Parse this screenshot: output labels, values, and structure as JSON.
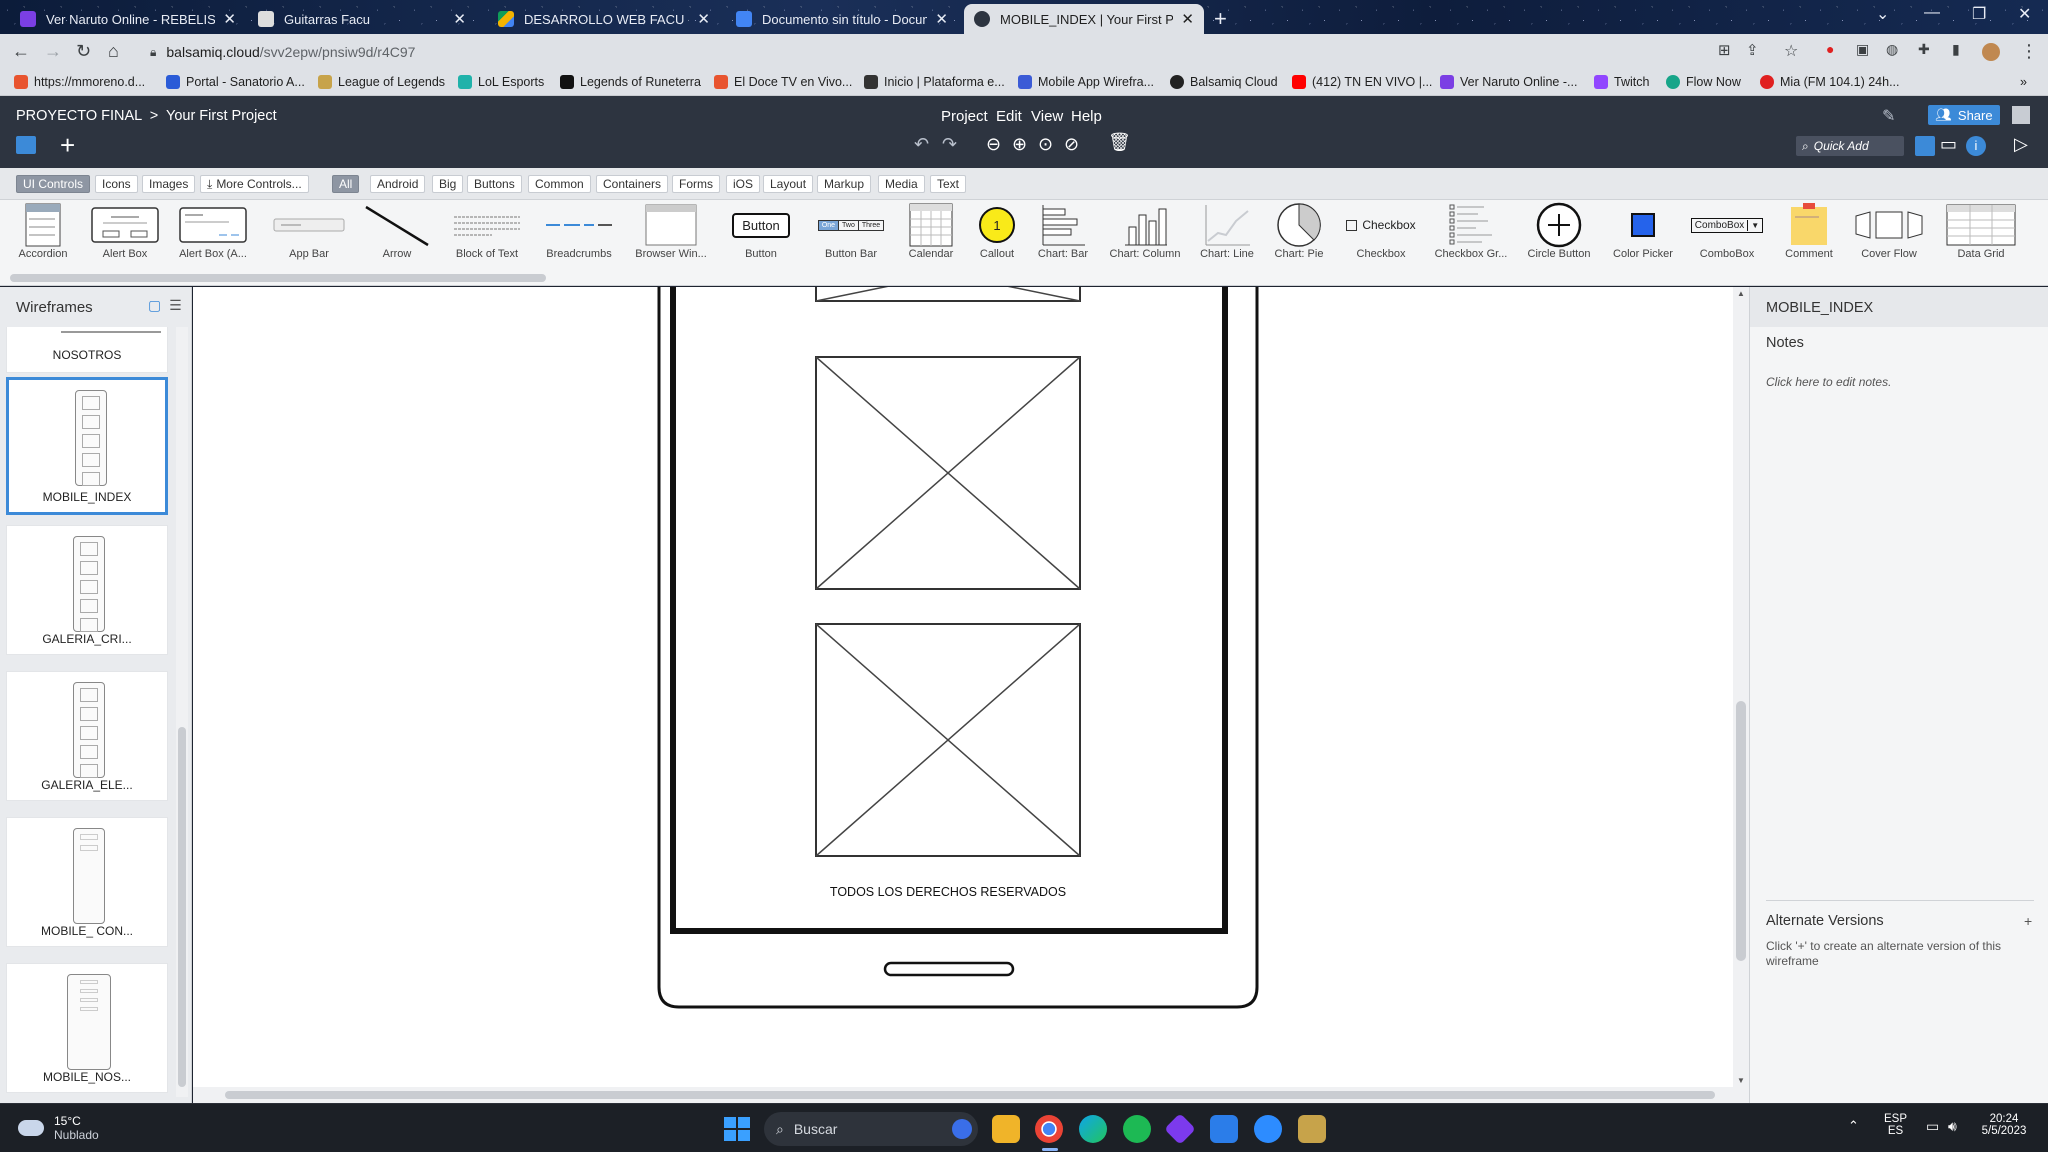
{
  "browser": {
    "tabs": [
      {
        "title": "Ver Naruto Online - REBELISPLUS",
        "color": "#7b3fe4",
        "active": false
      },
      {
        "title": "Guitarras Facu",
        "color": "#dddddd",
        "active": false
      },
      {
        "title": "DESARROLLO WEB FACU - Goog",
        "color": "#f4b400",
        "active": false
      },
      {
        "title": "Documento sin título - Documen",
        "color": "#4285f4",
        "active": false
      },
      {
        "title": "MOBILE_INDEX | Your First Projec",
        "color": "#2d3440",
        "active": true
      }
    ],
    "url_host": "balsamiq.cloud",
    "url_path": "/svv2epw/pnsiw9d/r4C97",
    "bookmarks": [
      {
        "label": "https://mmoreno.d...",
        "color": "#e8542f"
      },
      {
        "label": "Portal - Sanatorio A...",
        "color": "#2a5bd7"
      },
      {
        "label": "League of Legends",
        "color": "#c7a34a"
      },
      {
        "label": "LoL Esports",
        "color": "#20b2aa"
      },
      {
        "label": "Legends of Runeterra",
        "color": "#111111"
      },
      {
        "label": "El Doce TV en Vivo...",
        "color": "#e8542f"
      },
      {
        "label": "Inicio | Plataforma e...",
        "color": "#333333"
      },
      {
        "label": "Mobile App Wirefra...",
        "color": "#3b5bd6"
      },
      {
        "label": "Balsamiq Cloud",
        "color": "#222222"
      },
      {
        "label": "(412) TN EN VIVO |...",
        "color": "#ff0000"
      },
      {
        "label": "Ver Naruto Online -...",
        "color": "#7b3fe4"
      },
      {
        "label": "Twitch",
        "color": "#9146ff"
      },
      {
        "label": "Flow Now",
        "color": "#17a589"
      },
      {
        "label": "Mia (FM 104.1) 24h...",
        "color": "#e02020"
      }
    ]
  },
  "app": {
    "project": "PROYECTO FINAL",
    "separator": ">",
    "file": "Your First Project",
    "menu": [
      "Project",
      "Edit",
      "View",
      "Help"
    ],
    "share_label": "Share",
    "quick_add": "Quick Add"
  },
  "filters": {
    "left": [
      "UI Controls",
      "Icons",
      "Images",
      "More Controls..."
    ],
    "categories": [
      "All",
      "Android",
      "Big",
      "Buttons",
      "Common",
      "Containers",
      "Forms",
      "iOS",
      "Layout",
      "Markup",
      "Media",
      "Text"
    ]
  },
  "controls": [
    "Accordion",
    "Alert Box",
    "Alert Box (A...",
    "App Bar",
    "Arrow",
    "Block of Text",
    "Breadcrumbs",
    "Browser Win...",
    "Button",
    "Button Bar",
    "Calendar",
    "Callout",
    "Chart: Bar",
    "Chart: Column",
    "Chart: Line",
    "Chart: Pie",
    "Checkbox",
    "Checkbox Gr...",
    "Circle Button",
    "Color Picker",
    "ComboBox",
    "Comment",
    "Cover Flow",
    "Data Grid"
  ],
  "control_samples": {
    "button_text": "Button",
    "checkbox_text": "Checkbox",
    "combobox_text": "ComboBox",
    "callout_number": "1",
    "button_bar": [
      "One",
      "Two",
      "Three"
    ]
  },
  "wireframes": {
    "title": "Wireframes",
    "pages": [
      "NOSOTROS",
      "MOBILE_INDEX",
      "GALERIA_CRI...",
      "GALERIA_ELE...",
      "MOBILE_ CON...",
      "MOBILE_NOS..."
    ],
    "selected": "MOBILE_INDEX"
  },
  "canvas": {
    "footer_text": "TODOS LOS DERECHOS RESERVADOS"
  },
  "inspector": {
    "title": "MOBILE_INDEX",
    "notes_label": "Notes",
    "notes_hint": "Click here to edit notes.",
    "alt_title": "Alternate Versions",
    "alt_plus": "+",
    "alt_desc": "Click '+' to create an alternate version of this wireframe"
  },
  "taskbar": {
    "temp": "15°C",
    "weather": "Nublado",
    "search": "Buscar",
    "lang1": "ESP",
    "lang2": "ES",
    "time": "20:24",
    "date": "5/5/2023"
  }
}
